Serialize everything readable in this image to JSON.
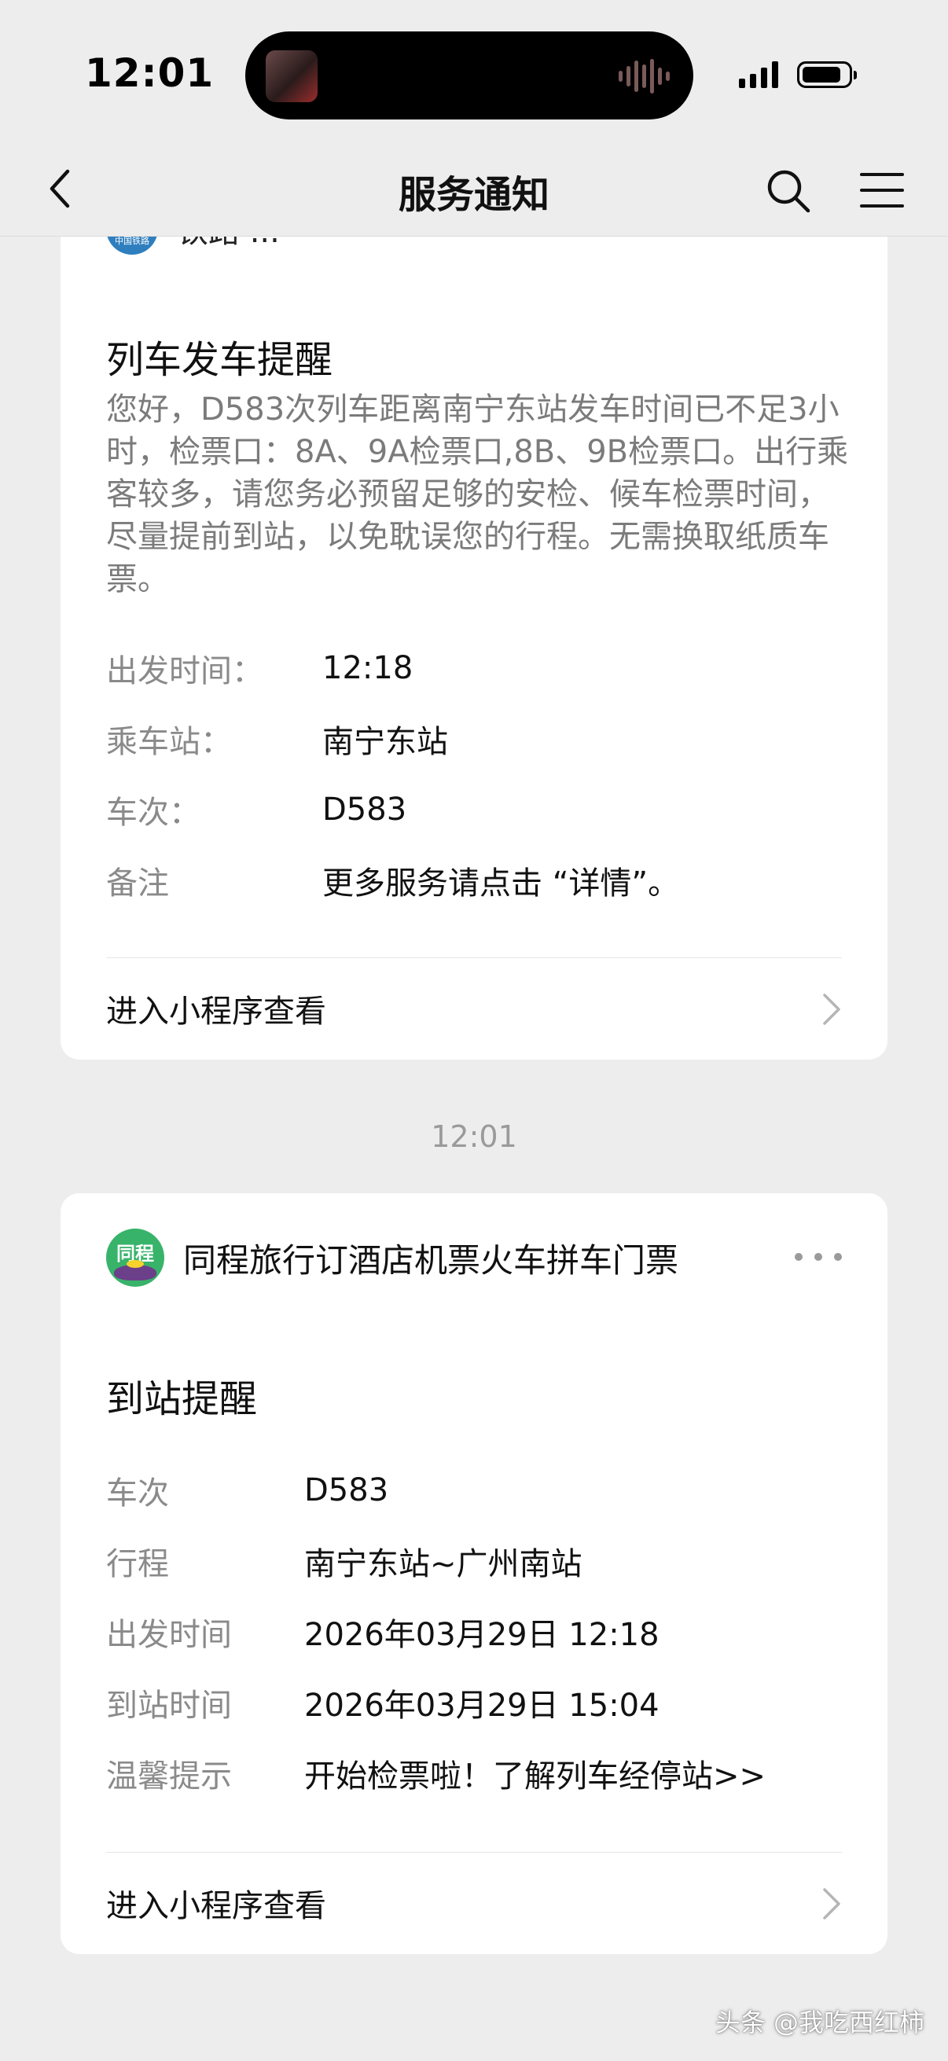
{
  "status_bar": {
    "time": "12:01"
  },
  "nav": {
    "title": "服务通知"
  },
  "card1": {
    "partial_header_name": "铁路 ...",
    "logo_text": "中国铁路",
    "title": "列车发车提醒",
    "body": "您好，D583次列车距离南宁东站发车时间已不足3小时，检票口：8A、9A检票口,8B、9B检票口。出行乘客较多，请您务必预留足够的安检、候车检票时间，尽量提前到站，以免耽误您的行程。无需换取纸质车票。",
    "fields": [
      {
        "label": "出发时间：",
        "value": "12:18"
      },
      {
        "label": "乘车站：",
        "value": "南宁东站"
      },
      {
        "label": "车次：",
        "value": "D583"
      },
      {
        "label": "备注",
        "value": "更多服务请点击 “详情”。"
      }
    ],
    "mini_program_link": "进入小程序查看"
  },
  "timestamp": "12:01",
  "card2": {
    "logo_text": "同程",
    "account_name": "同程旅行订酒店机票火车拼车门票",
    "title": "到站提醒",
    "fields": [
      {
        "label": "车次",
        "value": "D583"
      },
      {
        "label": "行程",
        "value": "南宁东站~广州南站"
      },
      {
        "label": "出发时间",
        "value": "2026年03月29日 12:18"
      },
      {
        "label": "到站时间",
        "value": "2026年03月29日 15:04"
      },
      {
        "label": "温馨提示",
        "value": "开始检票啦！了解列车经停站>>"
      }
    ],
    "mini_program_link": "进入小程序查看"
  },
  "watermark": "头条 @我吃西红柿"
}
